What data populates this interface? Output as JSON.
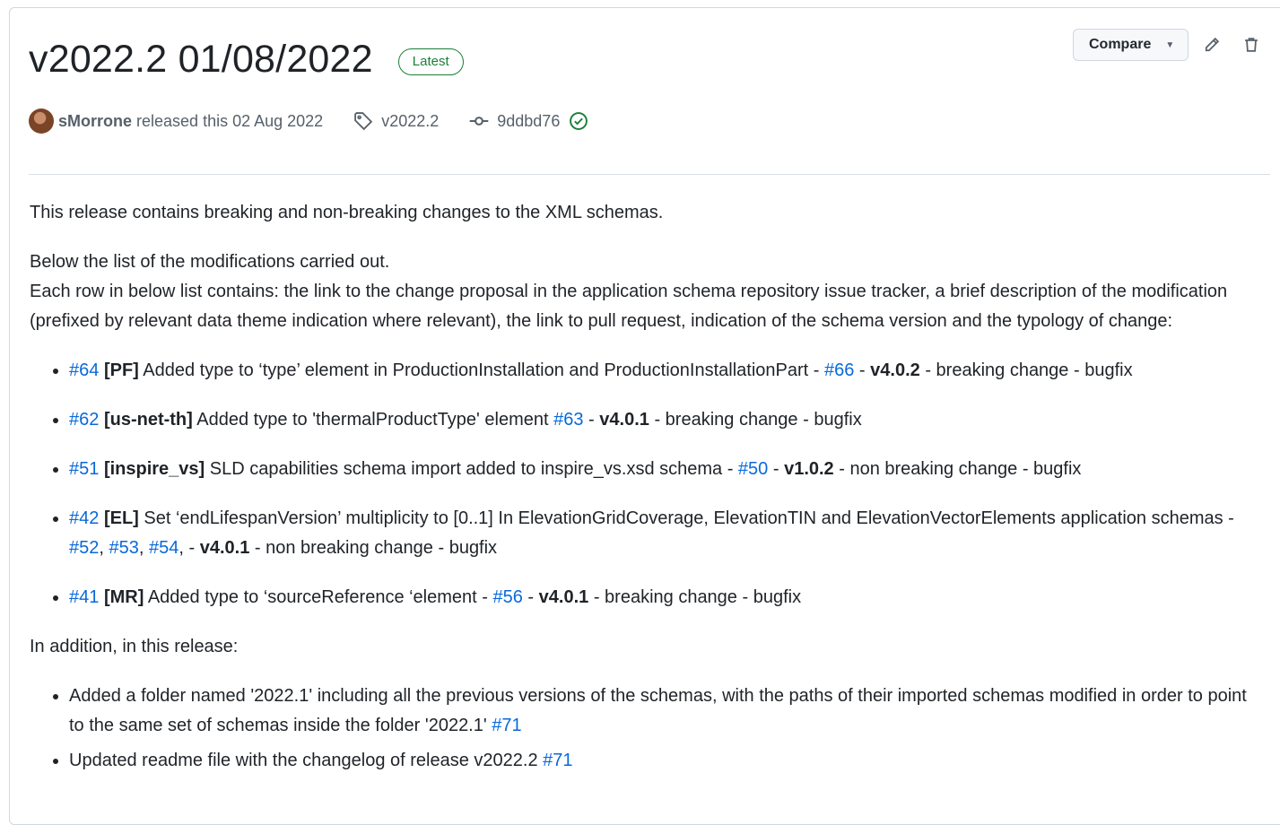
{
  "release": {
    "title": "v2022.2 01/08/2022",
    "badge": "Latest",
    "author": "sMorrone",
    "released_text": "released this 02 Aug 2022",
    "tag": "v2022.2",
    "commit": "9ddbd76",
    "compare_label": "Compare"
  },
  "icons": {
    "tag": "tag-icon",
    "commit": "git-commit-icon",
    "verified": "check-circle-icon",
    "edit": "pencil-icon",
    "delete": "trash-icon",
    "caret": "chevron-down-icon"
  },
  "colors": {
    "link": "#0969da",
    "latest": "#1a7f37",
    "text": "#1f2328",
    "muted": "#57606a"
  },
  "body": {
    "intro": "This release contains breaking and non-breaking changes to the XML schemas.",
    "list_intro_1": "Below the list of the modifications carried out.",
    "list_intro_2": "Each row in below list contains: the link to the change proposal in the application schema repository issue tracker, a brief description of the modification (prefixed by relevant data theme indication where relevant), the link to pull request, indication of the schema version and the typology of change:",
    "changes": [
      {
        "issue": "#64",
        "theme": "[PF]",
        "desc": " Added type to ‘type’ element in ProductionInstallation and ProductionInstallationPart - ",
        "prs": [
          "#66"
        ],
        "version": "v4.0.2",
        "type": " - breaking change - bugfix"
      },
      {
        "issue": "#62",
        "theme": "[us-net-th]",
        "desc": " Added type to 'thermalProductType' element ",
        "prs": [
          "#63"
        ],
        "version": "v4.0.1",
        "type": " - breaking change - bugfix"
      },
      {
        "issue": "#51",
        "theme": "[inspire_vs]",
        "desc": " SLD capabilities schema import added to inspire_vs.xsd schema - ",
        "prs": [
          "#50"
        ],
        "version": "v1.0.2",
        "type": " - non breaking change - bugfix"
      },
      {
        "issue": "#42",
        "theme": "[EL]",
        "desc": " Set ‘endLifespanVersion’ multiplicity to [0..1] In ElevationGridCoverage, ElevationTIN and ElevationVectorElements application schemas - ",
        "prs": [
          "#52",
          "#53",
          "#54"
        ],
        "version": "v4.0.1",
        "type": " - non breaking change - bugfix"
      },
      {
        "issue": "#41",
        "theme": "[MR]",
        "desc": " Added type to ‘sourceReference ‘element - ",
        "prs": [
          "#56"
        ],
        "version": "v4.0.1",
        "type": " - breaking change - bugfix"
      }
    ],
    "addition_intro": "In addition, in this release:",
    "additions": [
      {
        "text": "Added a folder named '2022.1' including all the previous versions of the schemas, with the paths of their imported schemas modified in order to point to the same set of schemas inside the folder '2022.1' ",
        "pr": "#71"
      },
      {
        "text": "Updated readme file with the changelog of release v2022.2 ",
        "pr": "#71"
      }
    ]
  }
}
